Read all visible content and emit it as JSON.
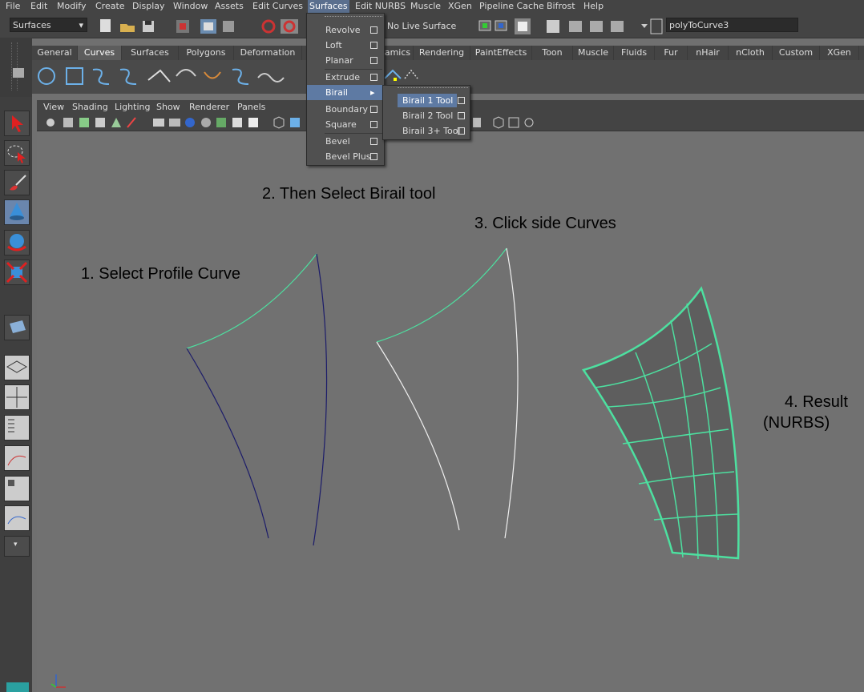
{
  "menubar": {
    "items": [
      "File",
      "Edit",
      "Modify",
      "Create",
      "Display",
      "Window",
      "Assets",
      "Edit Curves",
      "Surfaces",
      "Edit NURBS",
      "Muscle",
      "XGen",
      "Pipeline Cache",
      "Bifrost",
      "Help"
    ]
  },
  "statusline": {
    "menuset": "Surfaces",
    "live_surface": "No Live Surface",
    "object_name": "polyToCurve3"
  },
  "shelf": {
    "tabs": [
      "General",
      "Curves",
      "Surfaces",
      "Polygons",
      "Deformation",
      "Dynamics",
      "Rendering",
      "PaintEffects",
      "Toon",
      "Muscle",
      "Fluids",
      "Fur",
      "nHair",
      "nCloth",
      "Custom",
      "XGen"
    ],
    "tab_partial": "amics"
  },
  "panel": {
    "menus": [
      "View",
      "Shading",
      "Lighting",
      "Show",
      "Renderer",
      "Panels"
    ]
  },
  "surfaces_menu": {
    "items": [
      {
        "label": "Revolve"
      },
      {
        "label": "Loft"
      },
      {
        "label": "Planar"
      },
      {
        "label": "Extrude"
      },
      {
        "label": "Birail"
      },
      {
        "label": "Boundary"
      },
      {
        "label": "Square"
      },
      {
        "label": "Bevel"
      },
      {
        "label": "Bevel Plus"
      }
    ],
    "submenu_arrow": "▸"
  },
  "birail_submenu": {
    "items": [
      {
        "label": "Birail 1 Tool"
      },
      {
        "label": "Birail 2 Tool"
      },
      {
        "label": "Birail 3+ Tool"
      }
    ]
  },
  "annotations": {
    "step1": "1. Select Profile Curve",
    "step2": "2. Then Select Birail tool",
    "step3": "3. Click side Curves",
    "step4_line1": "4. Result",
    "step4_line2": "(NURBS)"
  },
  "colors": {
    "menu_highlight": "#5e7aa3",
    "curve_selected": "#4de0a0",
    "curve_profile": "#1c1c6a",
    "curve_white": "#f0f0f0"
  }
}
